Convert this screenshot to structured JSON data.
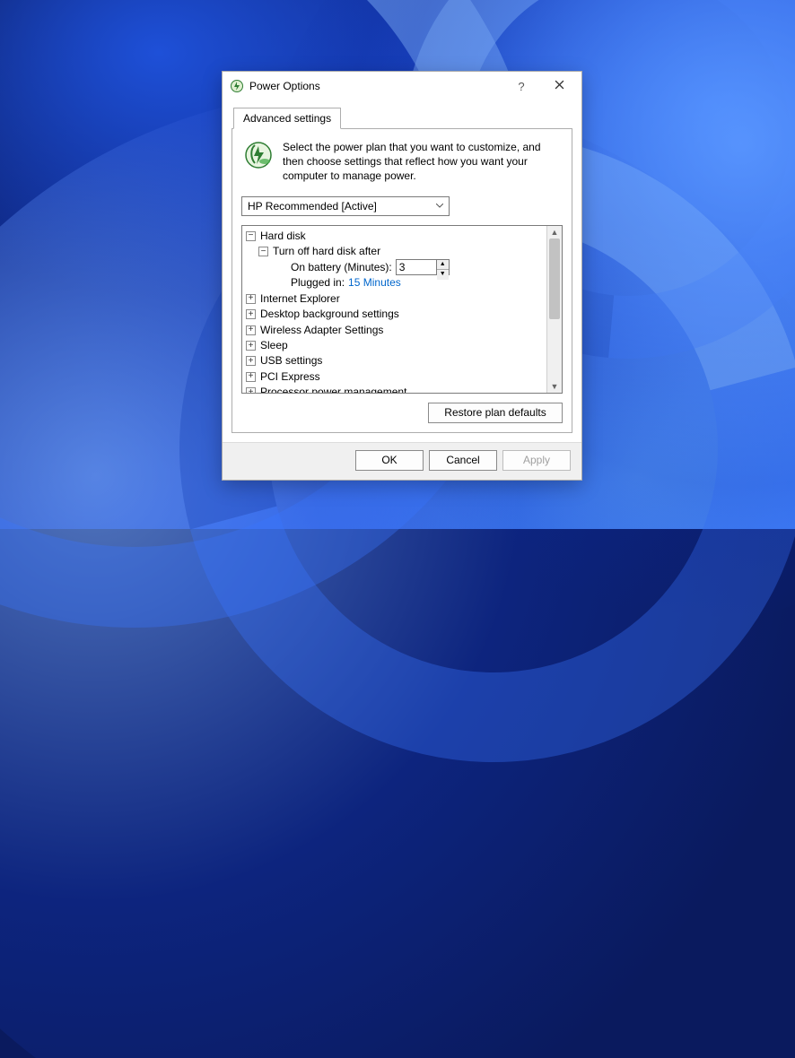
{
  "window": {
    "title": "Power Options"
  },
  "tab": {
    "label": "Advanced settings"
  },
  "description": "Select the power plan that you want to customize, and then choose settings that reflect how you want your computer to manage power.",
  "plan": {
    "selected": "HP Recommended [Active]"
  },
  "tree": {
    "hard_disk": {
      "label": "Hard disk",
      "turn_off": {
        "label": "Turn off hard disk after",
        "on_battery_label": "On battery (Minutes):",
        "on_battery_value": "3",
        "plugged_in_label": "Plugged in:",
        "plugged_in_value": "15 Minutes"
      }
    },
    "items": [
      "Internet Explorer",
      "Desktop background settings",
      "Wireless Adapter Settings",
      "Sleep",
      "USB settings",
      "PCI Express",
      "Processor power management"
    ]
  },
  "buttons": {
    "restore": "Restore plan defaults",
    "ok": "OK",
    "cancel": "Cancel",
    "apply": "Apply"
  }
}
